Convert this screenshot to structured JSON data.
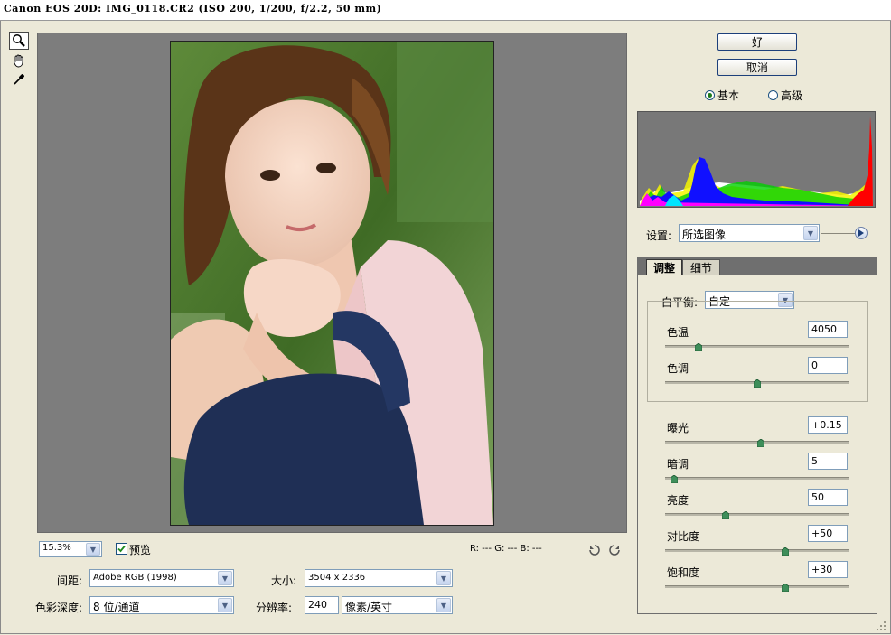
{
  "window": {
    "title": "Canon EOS 20D:  IMG_0118.CR2  (ISO 200, 1/200, f/2.2, 50 mm)"
  },
  "tools": [
    {
      "name": "zoom-tool",
      "icon": "magnifier-icon",
      "selected": true
    },
    {
      "name": "hand-tool",
      "icon": "hand-icon",
      "selected": false
    },
    {
      "name": "eyedropper-tool",
      "icon": "eyedropper-icon",
      "selected": false
    }
  ],
  "buttons": {
    "ok": "好",
    "cancel": "取消"
  },
  "mode": {
    "basic": "基本",
    "advanced": "高级",
    "selected": "basic"
  },
  "settings": {
    "label": "设置:",
    "value": "所选图像"
  },
  "tabs": {
    "adjust": "调整",
    "detail": "细节"
  },
  "white_balance": {
    "label": "白平衡:",
    "value": "自定"
  },
  "sliders": [
    {
      "key": "temp",
      "label": "色温",
      "value": "4050",
      "position": 0.18
    },
    {
      "key": "tint",
      "label": "色调",
      "value": "0",
      "position": 0.5
    },
    {
      "key": "exposure",
      "label": "曝光",
      "value": "+0.15",
      "position": 0.52
    },
    {
      "key": "shadows",
      "label": "暗调",
      "value": "5",
      "position": 0.05
    },
    {
      "key": "brightness",
      "label": "亮度",
      "value": "50",
      "position": 0.33
    },
    {
      "key": "contrast",
      "label": "对比度",
      "value": "+50",
      "position": 0.65
    },
    {
      "key": "saturation",
      "label": "饱和度",
      "value": "+30",
      "position": 0.65
    }
  ],
  "bottom": {
    "zoom": "15.3%",
    "preview_label": "预览",
    "preview_checked": true,
    "rgb_readout": "R: ---  G: ---  B: ---",
    "space_label": "间距:",
    "space_value": "Adobe RGB (1998)",
    "size_label": "大小:",
    "size_value": "3504 x 2336",
    "depth_label": "色彩深度:",
    "depth_value": "8 位/通道",
    "resolution_label": "分辨率:",
    "resolution_value": "240",
    "resolution_unit": "像素/英寸"
  },
  "colors": {
    "accent_border": "#1c3f7a",
    "preview_gray": "#7d7d7d",
    "thumb_green": "#3e8e5a"
  }
}
